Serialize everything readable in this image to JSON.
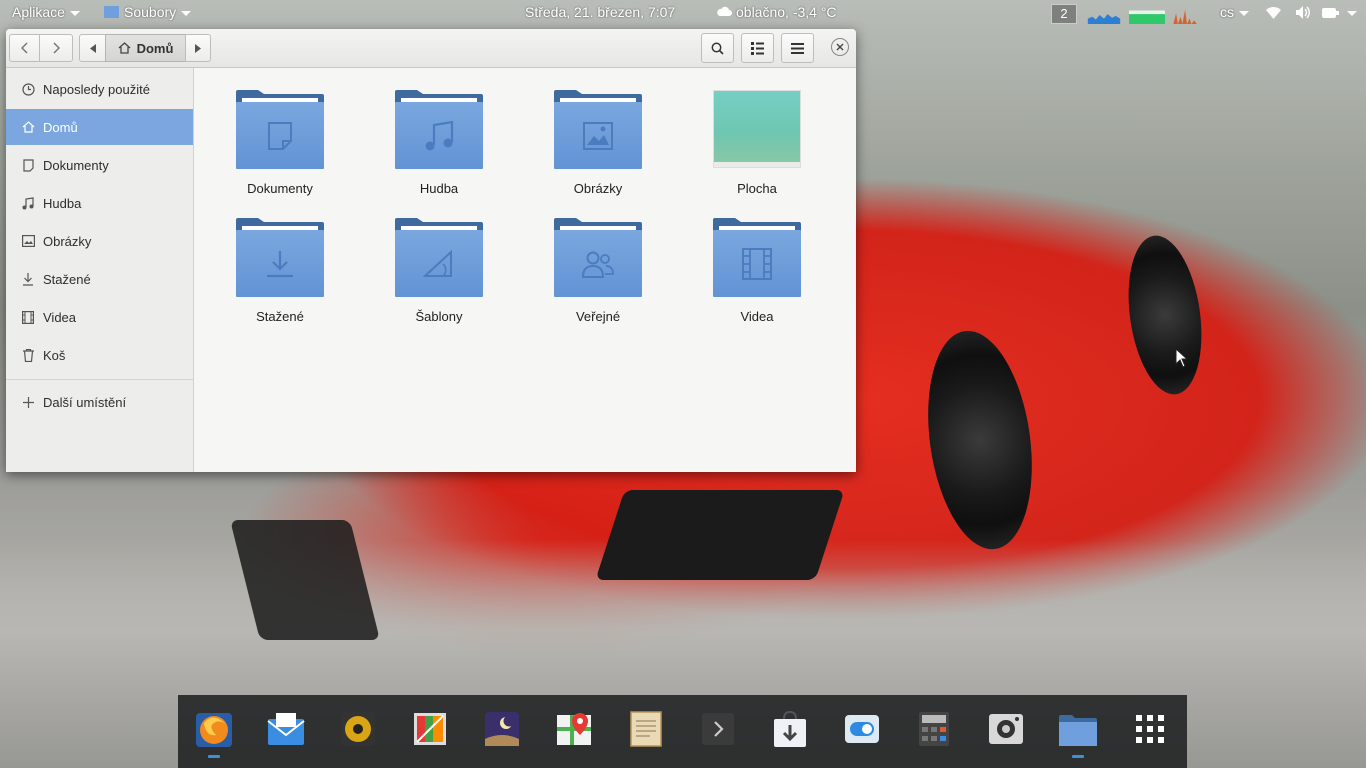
{
  "top_panel": {
    "apps_menu": "Aplikace",
    "files_menu": "Soubory",
    "datetime": "Středa, 21. březen,  7:07",
    "weather": "oblačno, -3,4 °C",
    "workspace": "2",
    "keyboard_layout": "cs"
  },
  "window": {
    "breadcrumb_home": "Domů",
    "sidebar": [
      {
        "label": "Naposledy použité",
        "icon": "clock-icon"
      },
      {
        "label": "Domů",
        "icon": "home-icon",
        "active": true
      },
      {
        "label": "Dokumenty",
        "icon": "document-icon"
      },
      {
        "label": "Hudba",
        "icon": "music-icon"
      },
      {
        "label": "Obrázky",
        "icon": "image-icon"
      },
      {
        "label": "Stažené",
        "icon": "download-icon"
      },
      {
        "label": "Videa",
        "icon": "film-icon"
      },
      {
        "label": "Koš",
        "icon": "trash-icon"
      },
      {
        "label": "Další umístění",
        "icon": "plus-icon"
      }
    ],
    "items": [
      {
        "label": "Dokumenty",
        "icon": "document-folder-icon"
      },
      {
        "label": "Hudba",
        "icon": "music-folder-icon"
      },
      {
        "label": "Obrázky",
        "icon": "pictures-folder-icon"
      },
      {
        "label": "Plocha",
        "icon": "desktop-thumbnail"
      },
      {
        "label": "Stažené",
        "icon": "download-folder-icon"
      },
      {
        "label": "Šablony",
        "icon": "templates-folder-icon"
      },
      {
        "label": "Veřejné",
        "icon": "public-folder-icon"
      },
      {
        "label": "Videa",
        "icon": "videos-folder-icon"
      }
    ]
  },
  "colors": {
    "accent": "#7ba6df",
    "folder": "#6f9fdc",
    "dock_indicator": "#3d8de2"
  },
  "dock": [
    {
      "app": "firefox-icon",
      "running": true
    },
    {
      "app": "mail-icon",
      "running": false
    },
    {
      "app": "music-player-icon",
      "running": false
    },
    {
      "app": "photos-icon",
      "running": false
    },
    {
      "app": "night-sky-icon",
      "running": false
    },
    {
      "app": "maps-icon",
      "running": false
    },
    {
      "app": "notes-icon",
      "running": false
    },
    {
      "app": "terminal-icon",
      "running": false
    },
    {
      "app": "app-installer-icon",
      "running": false
    },
    {
      "app": "settings-toggle-icon",
      "running": false
    },
    {
      "app": "calculator-icon",
      "running": false
    },
    {
      "app": "camera-icon",
      "running": false
    },
    {
      "app": "files-icon",
      "running": true
    },
    {
      "app": "app-grid-icon",
      "running": false
    }
  ]
}
